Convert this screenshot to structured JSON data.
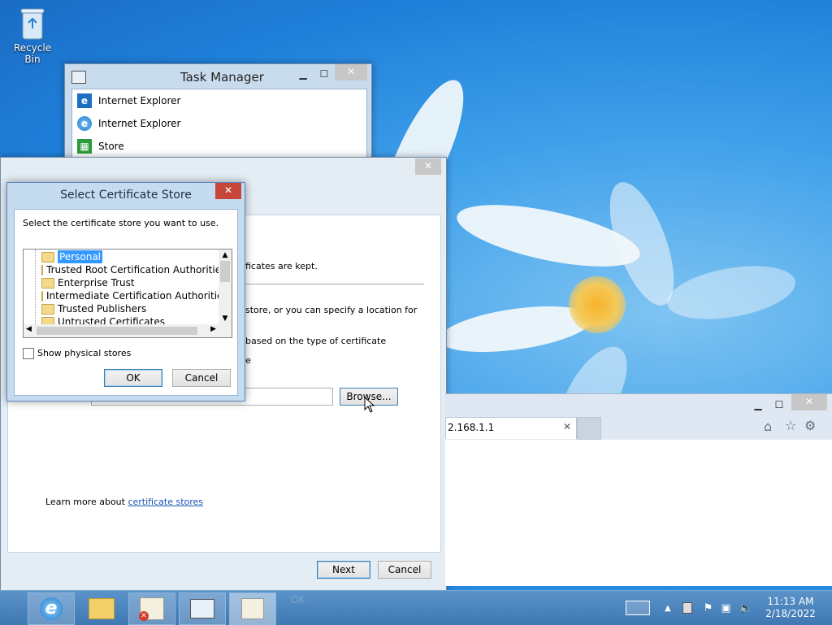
{
  "desktop": {
    "recycle_bin_label": "Recycle Bin"
  },
  "task_manager": {
    "title": "Task Manager",
    "items": [
      {
        "label": "Internet Explorer",
        "icon": "ie-metro-icon"
      },
      {
        "label": "Internet Explorer",
        "icon": "ie-icon"
      },
      {
        "label": "Store",
        "icon": "store-icon"
      }
    ]
  },
  "wizard": {
    "text_fragments": [
      "ficates are kept.",
      "store, or you can specify a location for",
      "based on the type of certificate",
      "e"
    ],
    "browse_label": "Browse...",
    "learn_more_prefix": "Learn more about ",
    "learn_more_link": "certificate stores",
    "next_label": "Next",
    "cancel_label": "Cancel"
  },
  "dialog": {
    "title": "Select Certificate Store",
    "instruction": "Select the certificate store you want to use.",
    "stores": [
      "Personal",
      "Trusted Root Certification Authorities",
      "Enterprise Trust",
      "Intermediate Certification Authorities",
      "Trusted Publishers",
      "Untrusted Certificates"
    ],
    "selected_store": "Personal",
    "show_physical_label": "Show physical stores",
    "show_physical_checked": false,
    "ok_label": "OK",
    "cancel_label": "Cancel"
  },
  "browser": {
    "tab_label": "2.168.1.1"
  },
  "taskbar": {
    "hidden_ok_label": "OK",
    "time": "11:13 AM",
    "date": "2/18/2022"
  },
  "colors": {
    "accent": "#3c7fb1",
    "close_red": "#c7463a",
    "link": "#1a55b6"
  }
}
